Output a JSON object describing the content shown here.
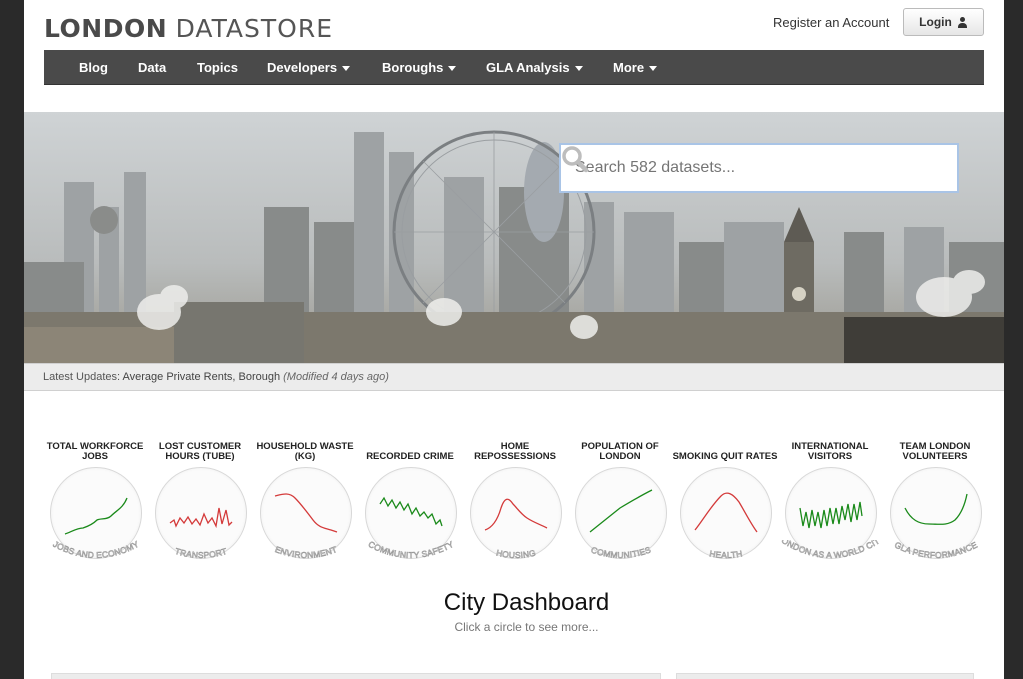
{
  "header": {
    "logo_bold": "LONDON",
    "logo_light": "DATASTORE",
    "register_link": "Register an Account",
    "login_label": "Login"
  },
  "nav": {
    "items": [
      {
        "label": "Blog",
        "dropdown": false
      },
      {
        "label": "Data",
        "dropdown": false
      },
      {
        "label": "Topics",
        "dropdown": false
      },
      {
        "label": "Developers",
        "dropdown": true
      },
      {
        "label": "Boroughs",
        "dropdown": true
      },
      {
        "label": "GLA Analysis",
        "dropdown": true
      },
      {
        "label": "More",
        "dropdown": true
      }
    ]
  },
  "search": {
    "placeholder": "Search 582 datasets...",
    "icon": "search-icon"
  },
  "updates": {
    "prefix": "Latest Updates:",
    "items": "Average Private Rents, Borough",
    "modified": "(Modified 4 days ago)"
  },
  "dashboard": {
    "title": "City Dashboard",
    "subtitle": "Click a circle to see more...",
    "items": [
      {
        "title": "TOTAL WORKFORCE JOBS",
        "category": "JOBS AND ECONOMY",
        "color": "#1a8a1a"
      },
      {
        "title": "LOST CUSTOMER HOURS (TUBE)",
        "category": "TRANSPORT",
        "color": "#d43a3a"
      },
      {
        "title": "HOUSEHOLD WASTE (KG)",
        "category": "ENVIRONMENT",
        "color": "#d43a3a"
      },
      {
        "title": "RECORDED CRIME",
        "category": "COMMUNITY SAFETY",
        "color": "#1a8a1a"
      },
      {
        "title": "HOME REPOSSESSIONS",
        "category": "HOUSING",
        "color": "#d43a3a"
      },
      {
        "title": "POPULATION OF LONDON",
        "category": "COMMUNITIES",
        "color": "#1a8a1a"
      },
      {
        "title": "SMOKING QUIT RATES",
        "category": "HEALTH",
        "color": "#d43a3a"
      },
      {
        "title": "INTERNATIONAL VISITORS",
        "category": "LONDON AS A WORLD CITY",
        "color": "#1a8a1a"
      },
      {
        "title": "TEAM LONDON VOLUNTEERS",
        "category": "GLA PERFORMANCE",
        "color": "#1a8a1a"
      }
    ]
  }
}
